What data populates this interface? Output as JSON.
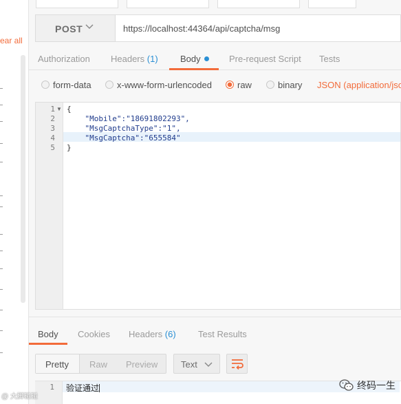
{
  "sidebar": {
    "clear_all_label": "ear all"
  },
  "request": {
    "method": "POST",
    "url": "https://localhost:44364/api/captcha/msg"
  },
  "request_tabs": {
    "authorization": "Authorization",
    "headers": "Headers",
    "headers_count": "(1)",
    "body": "Body",
    "prerequest": "Pre-request Script",
    "tests": "Tests"
  },
  "body_options": {
    "form_data": "form-data",
    "urlencoded": "x-www-form-urlencoded",
    "raw": "raw",
    "binary": "binary",
    "content_type": "JSON (application/json)",
    "selected": "raw"
  },
  "editor": {
    "line_numbers": [
      "1",
      "2",
      "3",
      "4",
      "5"
    ],
    "lines": [
      "{",
      "    \"Mobile\":\"18691802293\",",
      "    \"MsgCaptchaType\":\"1\",",
      "    \"MsgCaptcha\":\"655584\"",
      "}"
    ]
  },
  "response_tabs": {
    "body": "Body",
    "cookies": "Cookies",
    "headers": "Headers",
    "headers_count": "(6)",
    "test_results": "Test Results"
  },
  "response_view": {
    "pretty": "Pretty",
    "raw": "Raw",
    "preview": "Preview",
    "format": "Text",
    "selected": "Pretty"
  },
  "response_body": {
    "line_number": "1",
    "text": "验证通过"
  },
  "watermark": {
    "right_text": "终码一生",
    "left_text": "@ 大脚碰碰"
  },
  "colors": {
    "accent": "#f26b3a",
    "link_blue": "#2a8fd4"
  },
  "icons": [
    "chevron-down-icon",
    "wrap-lines-icon",
    "wechat-icon"
  ]
}
